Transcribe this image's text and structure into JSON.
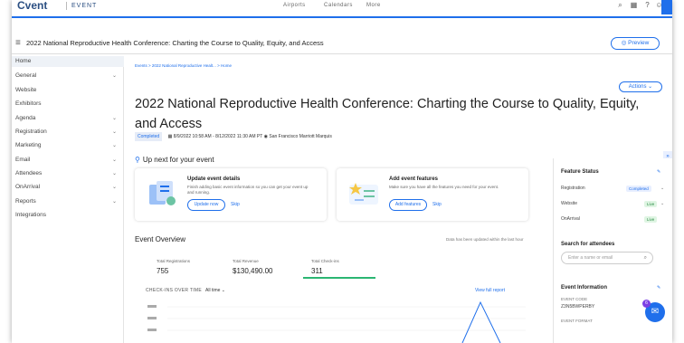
{
  "app": {
    "brand": "Cvent",
    "product": "EVENT"
  },
  "topnav": {
    "items": [
      "Airports",
      "Calendars",
      "More"
    ]
  },
  "titlebar": {
    "title": "2022 National Reproductive Health Conference: Charting the Course to Quality, Equity, and Access",
    "preview_label": "Preview"
  },
  "sidebar": {
    "items": [
      {
        "label": "Home",
        "chevron": false
      },
      {
        "label": "General",
        "chevron": true
      },
      {
        "label": "Website",
        "chevron": false
      },
      {
        "label": "Exhibitors",
        "chevron": false
      },
      {
        "label": "Agenda",
        "chevron": true
      },
      {
        "label": "Registration",
        "chevron": true
      },
      {
        "label": "Marketing",
        "chevron": true
      },
      {
        "label": "Email",
        "chevron": true
      },
      {
        "label": "Attendees",
        "chevron": true
      },
      {
        "label": "OnArrival",
        "chevron": true
      },
      {
        "label": "Reports",
        "chevron": true
      },
      {
        "label": "Integrations",
        "chevron": false
      }
    ]
  },
  "main": {
    "breadcrumb": "Events > 2022 National Reproductive Healt... > Home",
    "actions_label": "Actions",
    "title": "2022 National Reproductive Health Conference: Charting the Course to Quality, Equity, and Access",
    "status": "Completed",
    "dates": "8/9/2022 10:58 AM - 8/12/2022 11:30 AM PT",
    "venue": "San Francisco Marriott Marquis",
    "up_next": "Up next for your event",
    "cards": [
      {
        "title": "Update event details",
        "desc": "Finish adding basic event information so you can get your event up and running.",
        "button": "Update now",
        "skip": "Skip"
      },
      {
        "title": "Add event features",
        "desc": "Make sure you have all the features you need for your event.",
        "button": "Add features",
        "skip": "Skip"
      }
    ],
    "overview": {
      "title": "Event Overview",
      "note": "Data has been updated within the last hour",
      "stats": [
        {
          "label": "Total Registrations",
          "value": "755"
        },
        {
          "label": "Total Revenue",
          "value": "$130,490.00"
        },
        {
          "label": "Total Check-ins",
          "value": "311"
        }
      ],
      "chart_title": "CHECK-INS OVER TIME",
      "chart_filter": "All time",
      "chart_link": "View full report"
    }
  },
  "right": {
    "feature_status": "Feature Status",
    "features": [
      {
        "label": "Registration",
        "status": "Completed"
      },
      {
        "label": "Website",
        "status": "Live"
      },
      {
        "label": "OnArrival",
        "status": "Live"
      }
    ],
    "search_title": "Search for attendees",
    "search_placeholder": "Enter a name or email",
    "info_title": "Event Information",
    "info_label": "EVENT CODE",
    "info_value": "Z3N5BWPERBY",
    "info_label2": "EVENT FORMAT"
  },
  "fab_count": "6",
  "colors": {
    "accent": "#1f6feb",
    "live": "#2a8c44",
    "underline": "#2bb673"
  }
}
